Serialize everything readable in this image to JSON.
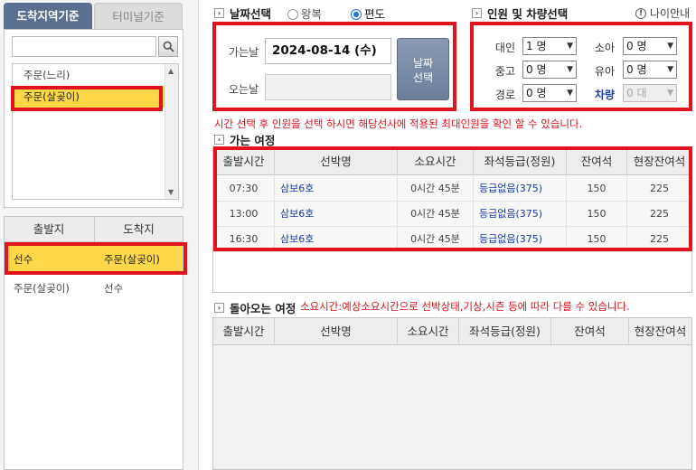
{
  "left_tabs": {
    "by_destination": "도착지역기준",
    "by_terminal": "터미널기준"
  },
  "port_list": [
    "주문(느리)",
    "주문(살곶이)"
  ],
  "route_table": {
    "headers": [
      "출발지",
      "도착지"
    ],
    "rows": [
      {
        "from": "선수",
        "to": "주문(살곶이)"
      },
      {
        "from": "주문(살곶이)",
        "to": "선수"
      }
    ]
  },
  "date_section": {
    "title": "날짜선택",
    "trip_round": "왕복",
    "trip_oneway": "편도",
    "go_label": "가는날",
    "return_label": "오는날",
    "go_date": "2024-08-14 (수)",
    "button_line1": "날짜",
    "button_line2": "선택"
  },
  "people_section": {
    "title": "인원 및 차량선택",
    "age_guide": "나이안내",
    "adult_label": "대인",
    "adult_value": "1 명",
    "teen_label": "중고",
    "teen_value": "0 명",
    "senior_label": "경로",
    "senior_value": "0 명",
    "child_label": "소아",
    "child_value": "0 명",
    "infant_label": "유아",
    "infant_value": "0 명",
    "vehicle_label": "차량",
    "vehicle_value": "0 대"
  },
  "notice_go": "시간 선택 후 인원을 선택 하시면 해당선사에 적용된 최대인원을 확인 할 수 있습니다.",
  "go_section_title": "가는 여정",
  "return_section_title": "돌아오는 여정",
  "notice_return": "소요시간:예상소요시간으로 선박상태,기상,시즌 등에 따라 다를 수 있습니다.",
  "schedule_headers": [
    "출발시간",
    "선박명",
    "소요시간",
    "좌석등급(정원)",
    "잔여석",
    "현장잔여석"
  ],
  "go_schedule": [
    {
      "time": "07:30",
      "ship": "삼보6호",
      "duration": "0시간 45분",
      "grade": "등급없음(375)",
      "remain": "150",
      "onsite": "225"
    },
    {
      "time": "13:00",
      "ship": "삼보6호",
      "duration": "0시간 45분",
      "grade": "등급없음(375)",
      "remain": "150",
      "onsite": "225"
    },
    {
      "time": "16:30",
      "ship": "삼보6호",
      "duration": "0시간 45분",
      "grade": "등급없음(375)",
      "remain": "150",
      "onsite": "225"
    }
  ],
  "colors": {
    "highlight_yellow": "#ffd84a",
    "annotation_red": "#e0141e",
    "link_blue": "#1d3aa8",
    "notice_red": "#d9111a"
  }
}
